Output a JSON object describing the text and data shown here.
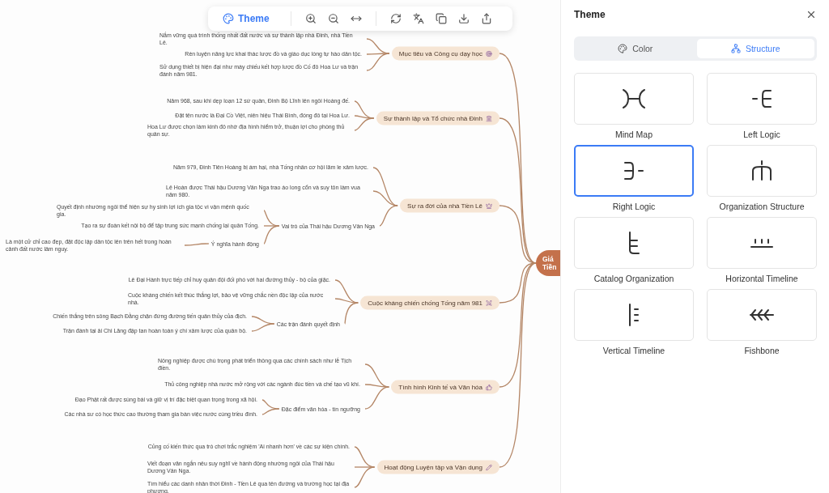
{
  "toolbar": {
    "theme_label": "Theme"
  },
  "mindmap": {
    "root": {
      "label": "Giá\nTiền"
    },
    "branches": [
      {
        "label": "Mục tiêu và Công cụ dạy học",
        "children": [
          {
            "label": "Nắm vững quá trình thống nhất đất nước và sự thành lập nhà Đinh, nhà Tiền Lê."
          },
          {
            "label": "Rèn luyện năng lực khai thác lược đồ và giáo dục lòng tự hào dân tộc."
          },
          {
            "label": "Sử dụng thiết bị hiện đại như máy chiếu kết hợp lược đồ Cố đô Hoa Lư và trận đánh năm 981."
          }
        ]
      },
      {
        "label": "Sự thành lập và Tổ chức nhà Đinh",
        "children": [
          {
            "label": "Năm 968, sau khi dẹp loạn 12 sứ quân, Đinh Bộ Lĩnh lên ngôi Hoàng đế."
          },
          {
            "label": "Đặt tên nước là Đại Cồ Việt, niên hiệu Thái Bình, đóng đô tại Hoa Lư."
          },
          {
            "label": "Hoa Lư được chọn làm kinh đô nhờ địa hình hiểm trở, thuận lợi cho phòng thủ quân sự."
          }
        ]
      },
      {
        "label": "Sự ra đời của nhà Tiền Lê",
        "children": [
          {
            "label": "Năm 979, Đinh Tiên Hoàng bị ám hại, nhà Tống nhân cơ hội lăm le xâm lược."
          },
          {
            "label": "Lê Hoàn được Thái hậu Dương Vân Nga trao áo long cổn và suy tôn làm vua năm 980."
          },
          {
            "label": "Vai trò của Thái hậu Dương Vân Nga",
            "children": [
              {
                "label": "Quyết định nhường ngôi thể hiện sự hy sinh lợi ích gia tộc vì vận mệnh quốc gia."
              },
              {
                "label": "Tạo ra sự đoàn kết nội bộ để tập trung sức mạnh chống lại quân Tống."
              },
              {
                "label": "Ý nghĩa hành động",
                "children": [
                  {
                    "label": "Là một cử chỉ cao đẹp, đặt độc lập dân tộc lên trên hết trong hoàn cảnh đất nước lâm nguy."
                  }
                ]
              }
            ]
          }
        ]
      },
      {
        "label": "Cuộc kháng chiến chống Tống năm 981",
        "children": [
          {
            "label": "Lê Đại Hành trực tiếp chỉ huy quân đội đối phó với hai đường thủy - bộ của giặc."
          },
          {
            "label": "Cuộc kháng chiến kết thúc thắng lợi, bảo vệ vững chắc nền độc lập của nước nhà."
          },
          {
            "label": "Các trận đánh quyết định",
            "children": [
              {
                "label": "Chiến thắng trên sông Bạch Đằng chặn đứng đường tiến quân thủy của địch."
              },
              {
                "label": "Trận đánh tại ải Chi Lăng đập tan hoàn toàn ý chí xâm lược của quân bộ."
              }
            ]
          }
        ]
      },
      {
        "label": "Tình hình Kinh tế và Văn hóa",
        "children": [
          {
            "label": "Nông nghiệp được chú trọng phát triển thông qua các chính sách như lễ Tịch điền."
          },
          {
            "label": "Thủ công nghiệp nhà nước mở rộng với các ngành đúc tiền và chế tạo vũ khí."
          },
          {
            "label": "Đặc điểm văn hóa - tín ngưỡng",
            "children": [
              {
                "label": "Đạo Phật rất được sùng bái và giữ vị trí đặc biệt quan trọng trong xã hội."
              },
              {
                "label": "Các nhà sư có học thức cao thường tham gia bàn việc nước cùng triều đình."
              }
            ]
          }
        ]
      },
      {
        "label": "Hoạt động Luyện tập và Vận dụng",
        "children": [
          {
            "label": "Củng cố kiến thức qua trò chơi trắc nghiệm 'Ai nhanh hơn' về các sự kiện chính."
          },
          {
            "label": "Viết đoạn văn ngắn nêu suy nghĩ về hành động nhường ngôi của Thái hậu Dương Vân Nga."
          },
          {
            "label": "Tìm hiểu các danh nhân thời Đinh - Tiền Lê qua tên đường và trường học tại địa phương."
          }
        ]
      }
    ]
  },
  "panel": {
    "title": "Theme",
    "tabs": [
      {
        "label": "Color",
        "selected": false
      },
      {
        "label": "Structure",
        "selected": true
      }
    ],
    "layouts": [
      {
        "label": "Mind Map",
        "selected": false
      },
      {
        "label": "Left Logic",
        "selected": false
      },
      {
        "label": "Right Logic",
        "selected": true
      },
      {
        "label": "Organization Structure",
        "selected": false
      },
      {
        "label": "Catalog Organization",
        "selected": false
      },
      {
        "label": "Horizontal Timeline",
        "selected": false
      },
      {
        "label": "Vertical Timeline",
        "selected": false
      },
      {
        "label": "Fishbone",
        "selected": false
      }
    ]
  }
}
